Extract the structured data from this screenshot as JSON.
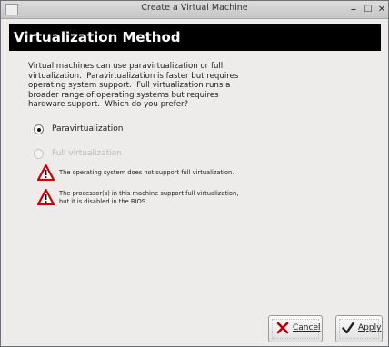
{
  "window": {
    "title": "Create a Virtual Machine",
    "menu_glyph": "⊟",
    "min_glyph": "⎯",
    "max_glyph": "☐",
    "close_glyph": "✕"
  },
  "banner": {
    "title": "Virtualization Method"
  },
  "description": "Virtual machines can use paravirtualization or full\nvirtualization.  Paravirtualization is faster but requires\noperating system support.  Full virtualization runs a\nbroader range of operating systems but requires\nhardware support.  Which do you prefer?",
  "options": {
    "para": {
      "label": "Paravirtualization",
      "selected": true
    },
    "full": {
      "label": "Full virtualization",
      "enabled": false
    }
  },
  "warnings": [
    {
      "text": "The operating system does not support full virtualization."
    },
    {
      "text": "The processor(s) in this machine support full virtualization,\nbut it is disabled in the BIOS."
    }
  ],
  "buttons": {
    "cancel": {
      "label": "Cancel",
      "icon": "cancel-x-icon"
    },
    "apply": {
      "label": "Apply",
      "icon": "checkmark-icon"
    }
  },
  "colors": {
    "warning_red": "#cc0000",
    "banner_bg": "#000000"
  }
}
